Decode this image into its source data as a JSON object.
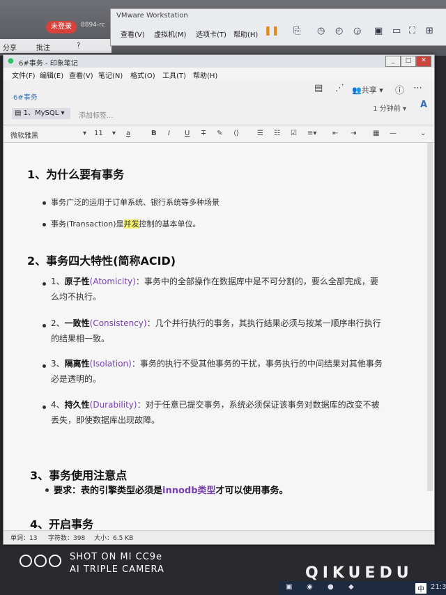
{
  "background_app": {
    "login_button": "未登录",
    "id_text": "8894-rc",
    "toolbar_share": "分享",
    "toolbar_note": "批注",
    "toolbar_help": "?"
  },
  "vmware": {
    "title": "VMware Workstation",
    "menu": [
      "查看(V)",
      "虚拟机(M)",
      "选项卡(T)",
      "帮助(H)"
    ]
  },
  "window": {
    "title": "6#事务 - 印象笔记",
    "menu": [
      "文件(F)",
      "编辑(E)",
      "查看(V)",
      "笔记(N)",
      "格式(O)",
      "工具(T)",
      "帮助(H)"
    ],
    "notebook_title": "6#事务",
    "share_label": "共享",
    "notebook_selector": "1、MySQL",
    "add_tag_placeholder": "添加标签...",
    "saved_time": "1 分钟前",
    "font_a": "A"
  },
  "format_toolbar": {
    "font_family": "微软雅黑",
    "font_size": "11",
    "text_color": "a",
    "bold": "B",
    "italic": "I",
    "underline": "U",
    "strike": "T"
  },
  "note": {
    "h1": "1、为什么要有事务",
    "b1": "事务广泛的运用于订单系统、银行系统等多种场景",
    "b2_pre": "事务(Transaction)是",
    "b2_hl": "并发",
    "b2_post": "控制的基本单位。",
    "h2": "2、事务四大特性(简称ACID)",
    "acid": [
      {
        "num": "1、",
        "term": "原子性",
        "en": "(Atomicity)",
        "text1": "：事务中的全部操作在数据库中是不可分割的，要么全部完成，要",
        "text2": "么均不执行。"
      },
      {
        "num": "2、",
        "term": "一致性",
        "en": "(Consistency)",
        "text1": "：几个并行执行的事务，其执行结果必须与按某一顺序串行执行",
        "text2": "的结果相一致。"
      },
      {
        "num": "3、",
        "term": "隔离性",
        "en": "(Isolation)",
        "text1": "：事务的执行不受其他事务的干扰，事务执行的中间结果对其他事务",
        "text2": "必是透明的。"
      },
      {
        "num": "4、",
        "term": "持久性",
        "en": "(Durability)",
        "text1": "：对于任意已提交事务，系统必须保证该事务对数据库的改变不被",
        "text2": "丢失，即使数据库出现故障。"
      }
    ],
    "h3": "3、事务使用注意点",
    "req_pre": "要求：表的引擎类型必须是",
    "req_hl": "innodb类型",
    "req_post": "才可以使用事务。",
    "h4": "4、开启事务"
  },
  "status": {
    "words": "单词：13",
    "chars": "字符数：398",
    "size": "大小：6.5 KB"
  },
  "watermark": {
    "brand": "QIKUEDU",
    "camera_line1": "SHOT ON MI CC9e",
    "camera_line2": "AI TRIPLE CAMERA"
  },
  "taskbar": {
    "ime": "中",
    "time": "21:3"
  },
  "colors": {
    "accent_blue": "#3a6fb5",
    "english_purple": "#7a3fb0",
    "highlight_yellow": "#f2f06a",
    "login_red": "#d9413a"
  }
}
